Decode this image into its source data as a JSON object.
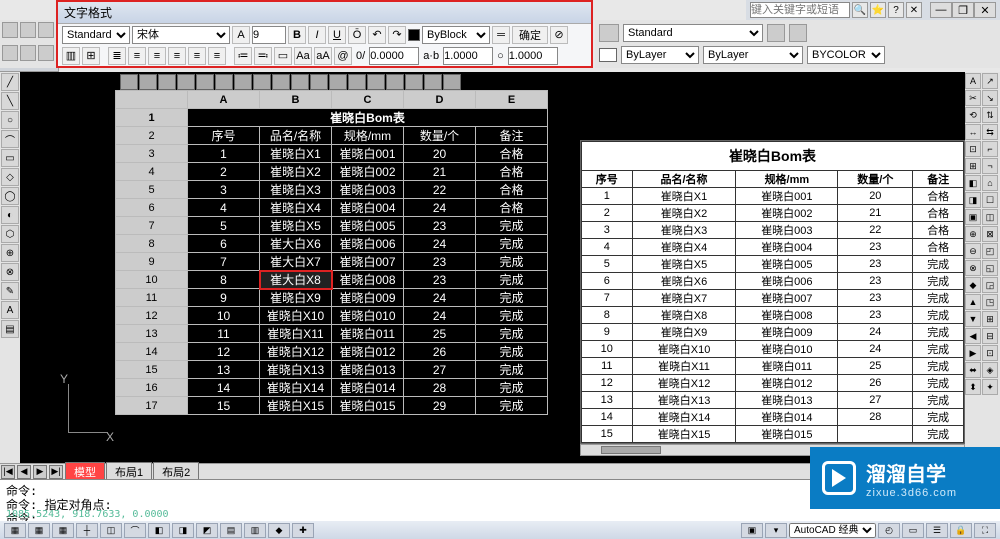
{
  "text_format": {
    "title": "文字格式",
    "style": "Standard",
    "font": "宋体",
    "annot_prefix": "A",
    "size": "9",
    "buttons": {
      "bold": "B",
      "italic": "I",
      "underline": "U",
      "overline": "Ō",
      "undo": "↶",
      "redo": "↷"
    },
    "color": "ByBlock",
    "ruler": "═",
    "ok": "确定",
    "help": "⊘",
    "row3": {
      "align_icons": [
        "≡",
        "≡",
        "≡",
        "≡",
        "≡",
        "≡",
        "≡",
        "≡",
        "≡"
      ],
      "list_icons": [
        "•",
        "1."
      ],
      "insert_icons": [
        "Aa",
        "aA",
        "@"
      ],
      "oblique_label": "0/",
      "oblique": "0.0000",
      "track_label": "a·b",
      "tracking": "1.0000",
      "width_label": "○",
      "widthf": "1.0000"
    }
  },
  "title_right": {
    "search_placeholder": "键入关键字或短语",
    "icons": [
      "🔍",
      "⭐",
      "?",
      "✕"
    ],
    "win_min": "—",
    "win_max": "❐",
    "win_close": "✕"
  },
  "row2_right": {
    "style_combo": "Standard",
    "layer_color_label": "ByLayer",
    "linetype": "ByLayer",
    "lineweight": "BYCOLOR"
  },
  "autocad_tab": "AutoCAD",
  "layout_tabs": {
    "nav": [
      "|◀",
      "◀",
      "▶",
      "▶|"
    ],
    "tabs": [
      {
        "label": "模型",
        "active": true
      },
      {
        "label": "布局1",
        "active": false
      },
      {
        "label": "布局2",
        "active": false
      }
    ]
  },
  "axis": {
    "y": "Y",
    "x": "X"
  },
  "sheet": {
    "cols": [
      "A",
      "B",
      "C",
      "D",
      "E"
    ],
    "rownums": [
      "1",
      "2",
      "3",
      "4",
      "5",
      "6",
      "7",
      "8",
      "9",
      "10",
      "11",
      "12",
      "13",
      "14",
      "15",
      "16",
      "17"
    ],
    "title": "崔晓白Bom表",
    "headers": [
      "序号",
      "品名/名称",
      "规格/mm",
      "数量/个",
      "备注"
    ],
    "edit_row": 10,
    "edit_col": 2,
    "rows": [
      [
        "1",
        "崔晓白X1",
        "崔晓白001",
        "20",
        "合格"
      ],
      [
        "2",
        "崔晓白X2",
        "崔晓白002",
        "21",
        "合格"
      ],
      [
        "3",
        "崔晓白X3",
        "崔晓白003",
        "22",
        "合格"
      ],
      [
        "4",
        "崔晓白X4",
        "崔晓白004",
        "24",
        "合格"
      ],
      [
        "5",
        "崔晓白X5",
        "崔晓白005",
        "23",
        "完成"
      ],
      [
        "6",
        "崔大白X6",
        "崔晓白006",
        "24",
        "完成"
      ],
      [
        "7",
        "崔大白X7",
        "崔晓白007",
        "23",
        "完成"
      ],
      [
        "8",
        "崔大白X8",
        "崔晓白008",
        "23",
        "完成"
      ],
      [
        "9",
        "崔晓白X9",
        "崔晓白009",
        "24",
        "完成"
      ],
      [
        "10",
        "崔晓白X10",
        "崔晓白010",
        "24",
        "完成"
      ],
      [
        "11",
        "崔晓白X11",
        "崔晓白011",
        "25",
        "完成"
      ],
      [
        "12",
        "崔晓白X12",
        "崔晓白012",
        "26",
        "完成"
      ],
      [
        "13",
        "崔晓白X13",
        "崔晓白013",
        "27",
        "完成"
      ],
      [
        "14",
        "崔晓白X14",
        "崔晓白014",
        "28",
        "完成"
      ],
      [
        "15",
        "崔晓白X15",
        "崔晓白015",
        "29",
        "完成"
      ]
    ]
  },
  "preview": {
    "title": "崔晓白Bom表",
    "headers": [
      "序号",
      "品名/名称",
      "规格/mm",
      "数量/个",
      "备注"
    ],
    "rows": [
      [
        "1",
        "崔晓白X1",
        "崔晓白001",
        "20",
        "合格"
      ],
      [
        "2",
        "崔晓白X2",
        "崔晓白002",
        "21",
        "合格"
      ],
      [
        "3",
        "崔晓白X3",
        "崔晓白003",
        "22",
        "合格"
      ],
      [
        "4",
        "崔晓白X4",
        "崔晓白004",
        "23",
        "合格"
      ],
      [
        "5",
        "崔晓白X5",
        "崔晓白005",
        "23",
        "完成"
      ],
      [
        "6",
        "崔晓白X6",
        "崔晓白006",
        "23",
        "完成"
      ],
      [
        "7",
        "崔晓白X7",
        "崔晓白007",
        "23",
        "完成"
      ],
      [
        "8",
        "崔晓白X8",
        "崔晓白008",
        "23",
        "完成"
      ],
      [
        "9",
        "崔晓白X9",
        "崔晓白009",
        "24",
        "完成"
      ],
      [
        "10",
        "崔晓白X10",
        "崔晓白010",
        "24",
        "完成"
      ],
      [
        "11",
        "崔晓白X11",
        "崔晓白011",
        "25",
        "完成"
      ],
      [
        "12",
        "崔晓白X12",
        "崔晓白012",
        "26",
        "完成"
      ],
      [
        "13",
        "崔晓白X13",
        "崔晓白013",
        "27",
        "完成"
      ],
      [
        "14",
        "崔晓白X14",
        "崔晓白014",
        "28",
        "完成"
      ],
      [
        "15",
        "崔晓白X15",
        "崔晓白015",
        "",
        "完成"
      ]
    ]
  },
  "cmd": {
    "line1": "命令:",
    "line2": "命令: 指定对角点:",
    "line3_prompt": "命令:",
    "coords": "1085.5243, 918.7633, 0.0000"
  },
  "status": {
    "buttons": [
      "▦",
      "▦",
      "▦",
      "┼",
      "◫",
      "⌒",
      "◧",
      "◨",
      "◩",
      "▤",
      "▥",
      "◆",
      "✚"
    ],
    "right_label": "AutoCAD 经典",
    "right_icons": [
      "▣",
      "▾",
      "◴",
      "▭",
      "☰",
      "🔒",
      "⛶"
    ]
  },
  "watermark": {
    "brand": "溜溜自学",
    "url": "zixue.3d66.com"
  },
  "chart_data": {
    "type": "table",
    "title": "崔晓白Bom表",
    "headers": [
      "序号",
      "品名/名称",
      "规格/mm",
      "数量/个",
      "备注"
    ],
    "rows": [
      [
        "1",
        "崔晓白X1",
        "崔晓白001",
        20,
        "合格"
      ],
      [
        "2",
        "崔晓白X2",
        "崔晓白002",
        21,
        "合格"
      ],
      [
        "3",
        "崔晓白X3",
        "崔晓白003",
        22,
        "合格"
      ],
      [
        "4",
        "崔晓白X4",
        "崔晓白004",
        24,
        "合格"
      ],
      [
        "5",
        "崔晓白X5",
        "崔晓白005",
        23,
        "完成"
      ],
      [
        "6",
        "崔大白X6",
        "崔晓白006",
        24,
        "完成"
      ],
      [
        "7",
        "崔大白X7",
        "崔晓白007",
        23,
        "完成"
      ],
      [
        "8",
        "崔大白X8",
        "崔晓白008",
        23,
        "完成"
      ],
      [
        "9",
        "崔晓白X9",
        "崔晓白009",
        24,
        "完成"
      ],
      [
        "10",
        "崔晓白X10",
        "崔晓白010",
        24,
        "完成"
      ],
      [
        "11",
        "崔晓白X11",
        "崔晓白011",
        25,
        "完成"
      ],
      [
        "12",
        "崔晓白X12",
        "崔晓白012",
        26,
        "完成"
      ],
      [
        "13",
        "崔晓白X13",
        "崔晓白013",
        27,
        "完成"
      ],
      [
        "14",
        "崔晓白X14",
        "崔晓白014",
        28,
        "完成"
      ],
      [
        "15",
        "崔晓白X15",
        "崔晓白015",
        29,
        "完成"
      ]
    ]
  }
}
